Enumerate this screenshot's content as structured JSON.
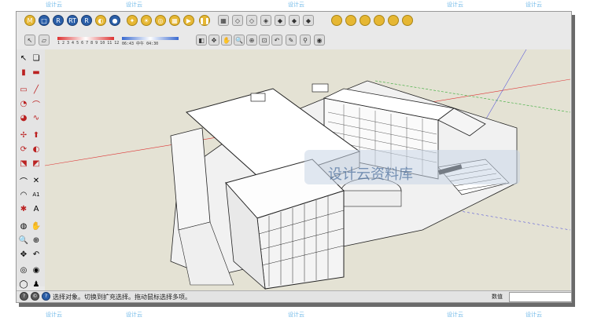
{
  "status_bar": {
    "hint_text": "选择对象。切换到扩充选择。拖动鼠标选择多项。",
    "measure_label": "数值"
  },
  "watermarks": [
    "设计云",
    "设计云",
    "设计云",
    "设计云",
    "设计云"
  ],
  "overlay_logo_text": "设计云资料库",
  "toolbar_row2_left_labels": {
    "slider1_ticks": "1 2 3 4 5 6 7 8 9 10 11 12",
    "slider2_ticks": "06:43   中午   04:30"
  },
  "colors": {
    "viewport_bg": "#e4e2d4",
    "axis_red": "#d33",
    "axis_green": "#3a3",
    "axis_blue": "#33d"
  }
}
